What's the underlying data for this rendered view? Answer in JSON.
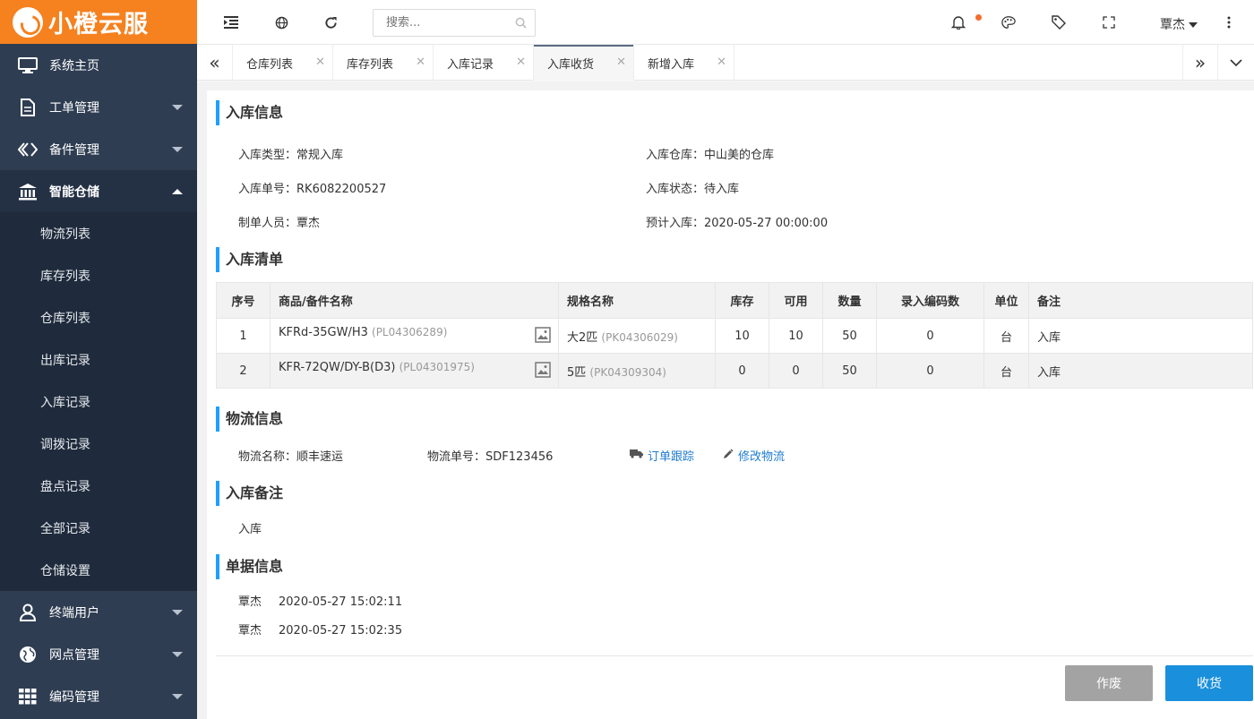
{
  "brand": {
    "name": "小橙云服"
  },
  "sidebar": {
    "items": [
      {
        "label": "系统主页"
      },
      {
        "label": "工单管理"
      },
      {
        "label": "备件管理"
      },
      {
        "label": "智能仓储"
      },
      {
        "label": "终端用户"
      },
      {
        "label": "网点管理"
      },
      {
        "label": "编码管理"
      }
    ],
    "submenu": [
      "物流列表",
      "库存列表",
      "仓库列表",
      "出库记录",
      "入库记录",
      "调拨记录",
      "盘点记录",
      "全部记录",
      "仓储设置"
    ]
  },
  "header": {
    "search_placeholder": "搜索...",
    "user": "覃杰"
  },
  "tabs": [
    {
      "label": "仓库列表"
    },
    {
      "label": "库存列表"
    },
    {
      "label": "入库记录"
    },
    {
      "label": "入库收货"
    },
    {
      "label": "新增入库"
    }
  ],
  "info": {
    "title": "入库信息",
    "type_label": "入库类型：",
    "type_value": "常规入库",
    "warehouse_label": "入库仓库：",
    "warehouse_value": "中山美的仓库",
    "no_label": "入库单号：",
    "no_value": "RK6082200527",
    "status_label": "入库状态：",
    "status_value": "待入库",
    "maker_label": "制单人员：",
    "maker_value": "覃杰",
    "eta_label": "预计入库：",
    "eta_value": "2020-05-27 00:00:00"
  },
  "list": {
    "title": "入库清单",
    "headers": [
      "序号",
      "商品/备件名称",
      "规格名称",
      "库存",
      "可用",
      "数量",
      "录入编码数",
      "单位",
      "备注"
    ],
    "rows": [
      {
        "idx": "1",
        "name": "KFRd-35GW/H3",
        "code": "(PL04306289)",
        "spec": "大2匹",
        "spec_code": "(PK04306029)",
        "stock": "10",
        "avail": "10",
        "qty": "50",
        "coded": "0",
        "unit": "台",
        "note": "入库"
      },
      {
        "idx": "2",
        "name": "KFR-72QW/DY-B(D3)",
        "code": "(PL04301975)",
        "spec": "5匹",
        "spec_code": "(PK04309304)",
        "stock": "0",
        "avail": "0",
        "qty": "50",
        "coded": "0",
        "unit": "台",
        "note": "入库"
      }
    ]
  },
  "logistics": {
    "title": "物流信息",
    "name_label": "物流名称：",
    "name_value": "顺丰速运",
    "no_label": "物流单号：",
    "no_value": "SDF123456",
    "track_link": "订单跟踪",
    "edit_link": "修改物流"
  },
  "remark": {
    "title": "入库备注",
    "text": "入库"
  },
  "docs": {
    "title": "单据信息",
    "entries": [
      {
        "user": "覃杰",
        "time": "2020-05-27 15:02:11"
      },
      {
        "user": "覃杰",
        "time": "2020-05-27 15:02:35"
      }
    ]
  },
  "actions": {
    "void": "作废",
    "receive": "收货"
  },
  "colors": {
    "brand": "#f5811f",
    "sidebar": "#2e3d52",
    "accent": "#1e9fff",
    "primary_button": "#1a8fdc"
  }
}
